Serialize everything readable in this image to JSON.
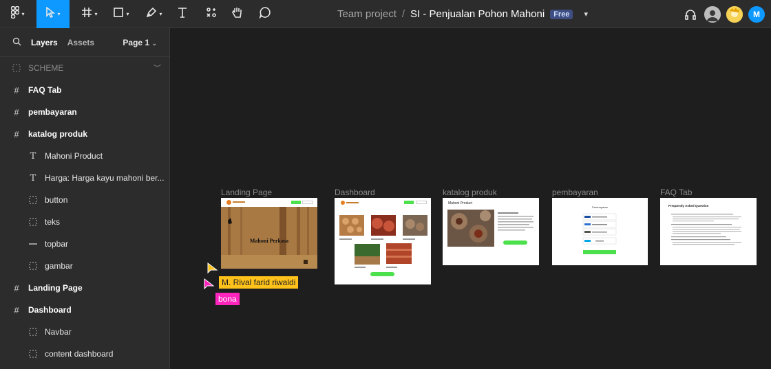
{
  "toolbar": {
    "tools": [
      "main-menu",
      "move",
      "frame",
      "shape",
      "pen",
      "text",
      "resources",
      "hand",
      "comment"
    ]
  },
  "title": {
    "team": "Team project",
    "separator": "/",
    "file": "SI - Penjualan Pohon Mahoni",
    "plan_badge": "Free"
  },
  "collaborators": [
    {
      "initial": "M",
      "color": "#0d99ff"
    }
  ],
  "layers_panel": {
    "tab_layers": "Layers",
    "tab_assets": "Assets",
    "page_selector": "Page 1",
    "items": [
      {
        "label": "SCHEME",
        "kind": "section",
        "icon": "dashed-frame-icon"
      },
      {
        "label": "FAQ Tab",
        "kind": "frame",
        "icon": "frame-hash-icon"
      },
      {
        "label": "pembayaran",
        "kind": "frame",
        "icon": "frame-hash-icon"
      },
      {
        "label": "katalog produk",
        "kind": "frame",
        "icon": "frame-hash-icon"
      },
      {
        "label": "Mahoni Product",
        "kind": "text",
        "icon": "text-icon"
      },
      {
        "label": "Harga: Harga kayu mahoni ber...",
        "kind": "text",
        "icon": "text-icon"
      },
      {
        "label": "button",
        "kind": "group",
        "icon": "dashed-frame-icon"
      },
      {
        "label": "teks",
        "kind": "group",
        "icon": "dashed-frame-icon"
      },
      {
        "label": "topbar",
        "kind": "line",
        "icon": "line-icon"
      },
      {
        "label": "gambar",
        "kind": "group",
        "icon": "dashed-frame-icon"
      },
      {
        "label": "Landing Page",
        "kind": "frame",
        "icon": "frame-hash-icon"
      },
      {
        "label": "Dashboard",
        "kind": "frame",
        "icon": "frame-hash-icon"
      },
      {
        "label": "Navbar",
        "kind": "group",
        "icon": "dashed-frame-icon"
      },
      {
        "label": "content dashboard",
        "kind": "group",
        "icon": "dashed-frame-icon"
      }
    ]
  },
  "canvas": {
    "frames": [
      {
        "label": "Landing Page",
        "hero_text": "Mahoni Perkasa"
      },
      {
        "label": "Dashboard"
      },
      {
        "label": "katalog produk",
        "heading": "Mahoni Product"
      },
      {
        "label": "pembayaran",
        "heading": "Pembayaran"
      },
      {
        "label": "FAQ Tab",
        "heading": "Frequently Asked Question"
      }
    ],
    "cursors": [
      {
        "name": "M. Rival farid riwaldi",
        "color": "#ffc21a"
      },
      {
        "name": "bona",
        "color": "#ff24bd"
      }
    ]
  },
  "colors": {
    "accent": "#0d99ff",
    "button_green": "#4ce04c",
    "wood": "#a0612b"
  }
}
